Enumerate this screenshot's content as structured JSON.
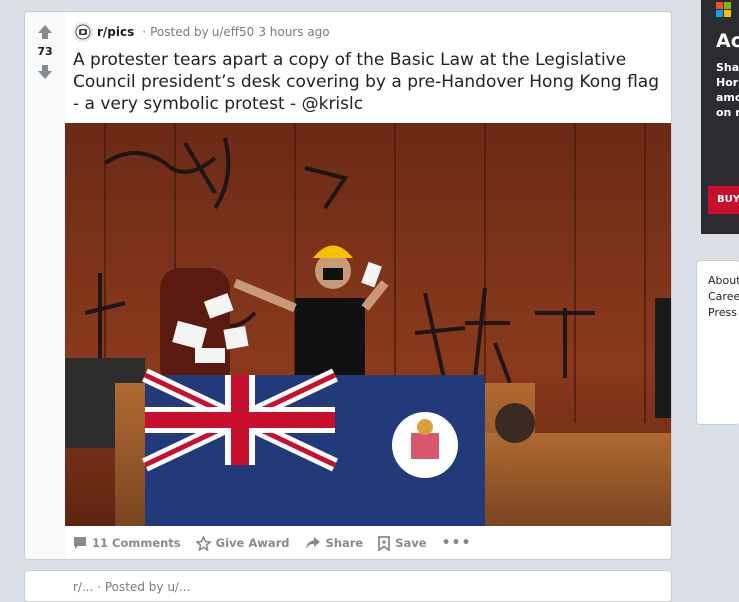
{
  "post": {
    "score": "73",
    "subreddit": "r/pics",
    "posted_by": "Posted by",
    "author": "u/eff50",
    "time": "3 hours ago",
    "title": "A protester tears apart a copy of the Basic Law at the Legislative Council president’s desk covering by a pre-Handover Hong Kong flag - a very symbolic protest - @krislc",
    "actions": {
      "comments": "11 Comments",
      "award": "Give Award",
      "share": "Share",
      "save": "Save",
      "more": "•••"
    }
  },
  "ad": {
    "headline": "Ac",
    "line1": "Sha",
    "line2": "Hor",
    "line3": "amc",
    "line4": "on r",
    "cta": "BUY"
  },
  "footer_links": [
    "About",
    "Caree",
    "Press"
  ],
  "next_post": {
    "meta": "r/... · Posted by u/..."
  },
  "colors": {
    "upvote": "#878a8c",
    "brand_red": "#c8102e",
    "flag_blue": "#223a7a"
  }
}
